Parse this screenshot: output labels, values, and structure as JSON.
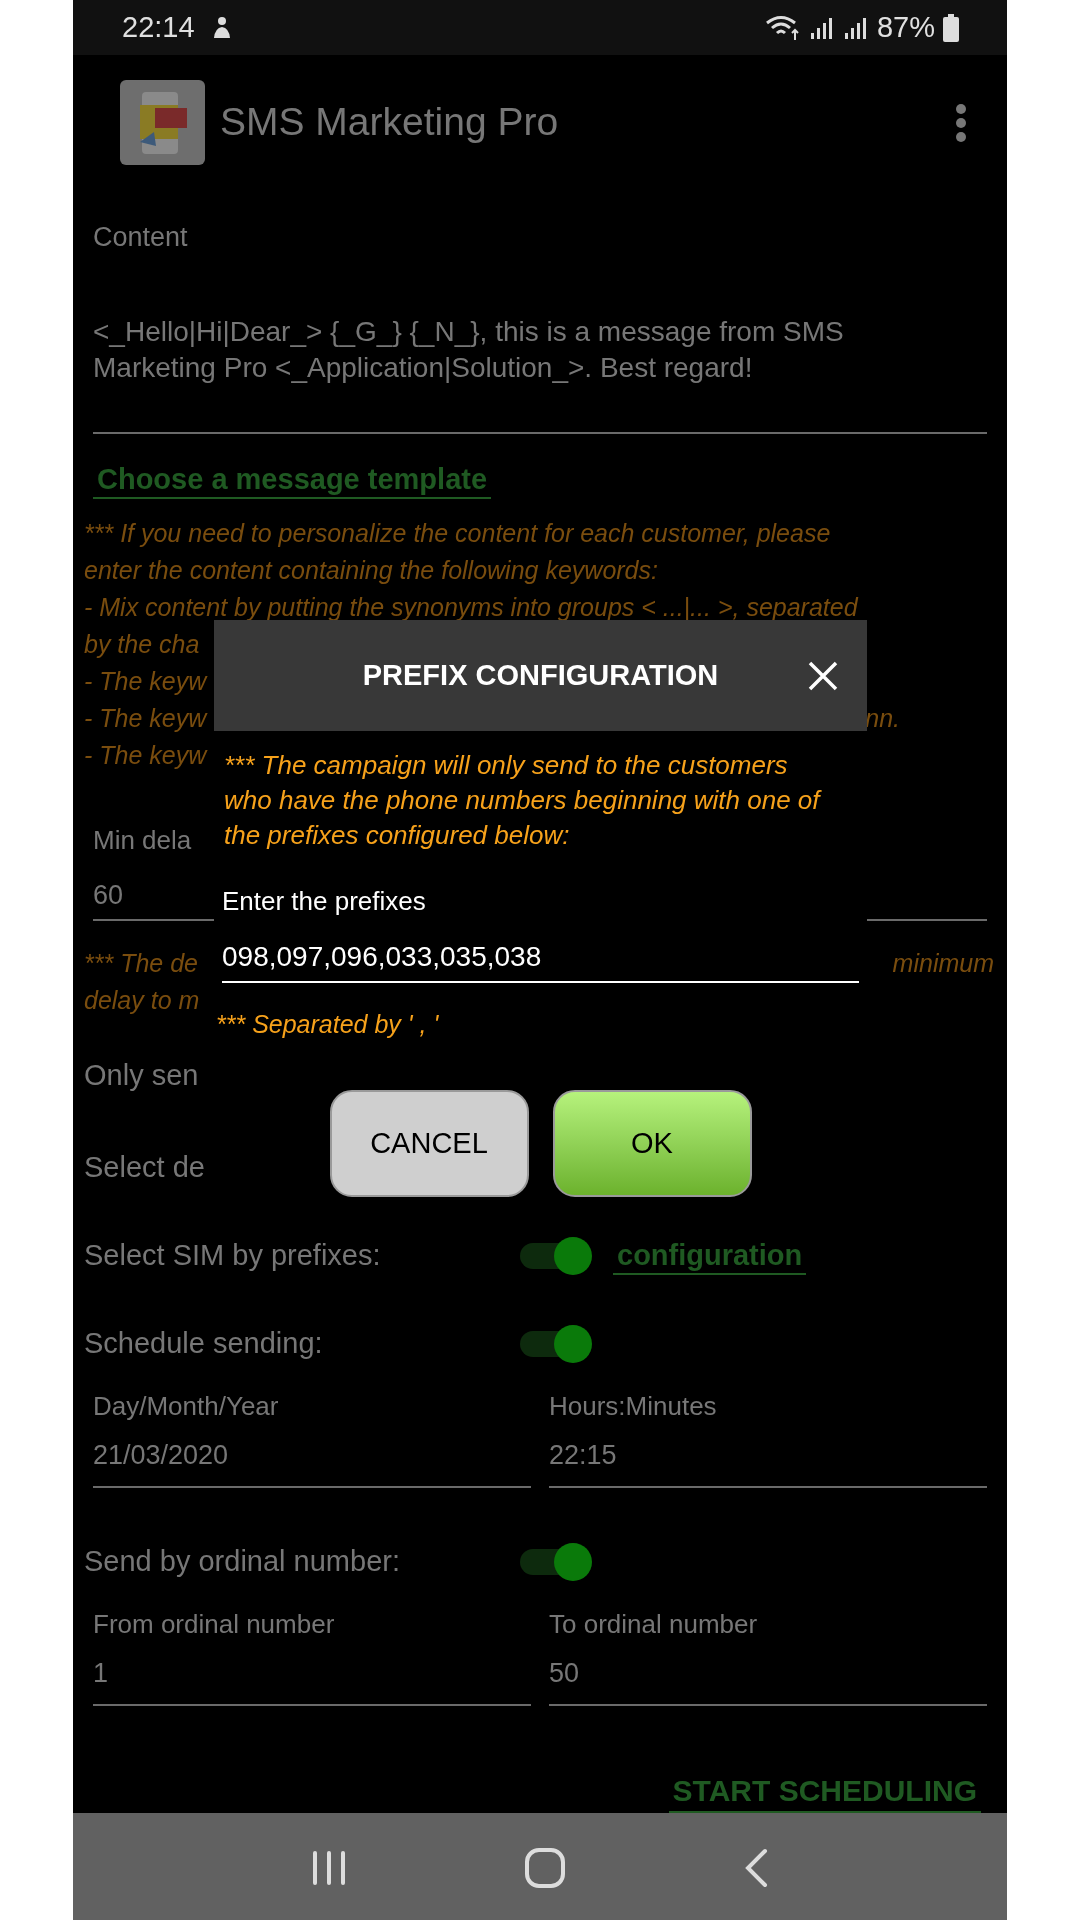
{
  "status_bar": {
    "time": "22:14",
    "battery": "87%"
  },
  "app_bar": {
    "title": "SMS Marketing Pro"
  },
  "content": {
    "label": "Content",
    "message": "<_Hello|Hi|Dear_> {_G_} {_N_}, this is a message from SMS Marketing Pro <_Application|Solution_>. Best regard!"
  },
  "template_link": "Choose a message template",
  "template_notes": [
    {
      "left": "*** If you need to personalize the content for each customer, please"
    },
    {
      "left": "enter the content containing the following keywords:"
    },
    {
      "left": "- Mix content by putting the synonyms into groups < ...|... >, separated"
    },
    {
      "left": "by the cha"
    },
    {
      "left": "- The keyw"
    },
    {
      "left": "- The keyw",
      "right": "nn."
    },
    {
      "left": "- The keyw"
    }
  ],
  "min_delay": {
    "label": "Min dela",
    "value": "60"
  },
  "delay_note": [
    {
      "left": "*** The de",
      "right": "minimum"
    },
    {
      "left": "delay to m"
    }
  ],
  "covered_options": [
    "Only sen",
    "Select de"
  ],
  "settings": [
    {
      "kind": "toggle",
      "label": "Select SIM by prefixes:",
      "on": true,
      "link": "configuration"
    },
    {
      "kind": "toggle",
      "label": "Schedule sending:",
      "on": true
    },
    {
      "kind": "fields",
      "fields": [
        {
          "label": "Day/Month/Year",
          "value": "21/03/2020"
        },
        {
          "label": "Hours:Minutes",
          "value": "22:15"
        }
      ]
    },
    {
      "kind": "toggle",
      "label": "Send by ordinal number:",
      "on": true
    },
    {
      "kind": "fields",
      "fields": [
        {
          "label": "From ordinal number",
          "value": "1"
        },
        {
          "label": "To ordinal number",
          "value": "50"
        }
      ]
    }
  ],
  "start_button": "START SCHEDULING",
  "dialog": {
    "title": "PREFIX CONFIGURATION",
    "message": "*** The campaign will only send to the customers who have the phone numbers beginning with one of the prefixes configured below:",
    "field_label": "Enter the prefixes",
    "field_value": "098,097,096,033,035,038",
    "hint": "*** Separated by ' , '",
    "buttons": [
      {
        "kind": "cancel",
        "label": "CANCEL"
      },
      {
        "kind": "ok",
        "label": "OK"
      }
    ]
  }
}
